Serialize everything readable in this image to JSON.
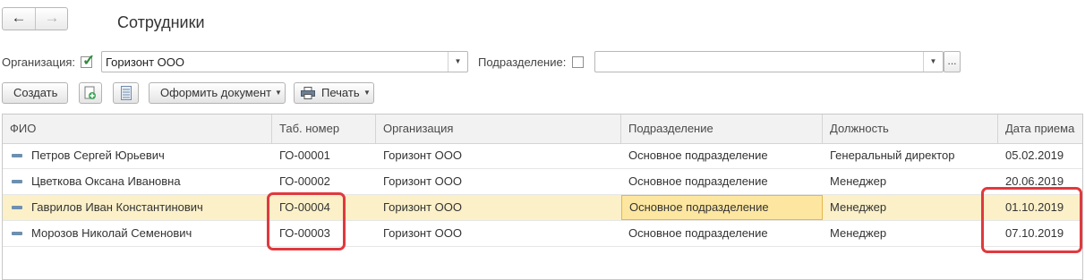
{
  "window": {
    "title": "Сотрудники"
  },
  "nav": {
    "back_icon": "←",
    "forward_icon": "→"
  },
  "filters": {
    "org_label": "Организация:",
    "org_checked": true,
    "org_value": "Горизонт ООО",
    "dept_label": "Подразделение:",
    "dept_checked": false,
    "dept_value": "",
    "more_label": "..."
  },
  "toolbar": {
    "create_label": "Создать",
    "format_doc_label": "Оформить документ",
    "print_label": "Печать"
  },
  "table": {
    "columns": [
      "ФИО",
      "Таб. номер",
      "Организация",
      "Подразделение",
      "Должность",
      "Дата приема"
    ],
    "rows": [
      {
        "fio": "Петров Сергей Юрьевич",
        "tab": "ГО-00001",
        "org": "Горизонт ООО",
        "dept": "Основное подразделение",
        "pos": "Генеральный директор",
        "date": "05.02.2019"
      },
      {
        "fio": "Цветкова Оксана Ивановна",
        "tab": "ГО-00002",
        "org": "Горизонт ООО",
        "dept": "Основное подразделение",
        "pos": "Менеджер",
        "date": "20.06.2019"
      },
      {
        "fio": "Гаврилов Иван Константинович",
        "tab": "ГО-00004",
        "org": "Горизонт ООО",
        "dept": "Основное подразделение",
        "pos": "Менеджер",
        "date": "01.10.2019"
      },
      {
        "fio": "Морозов Николай Семенович",
        "tab": "ГО-00003",
        "org": "Горизонт ООО",
        "dept": "Основное подразделение",
        "pos": "Менеджер",
        "date": "07.10.2019"
      }
    ],
    "selected_row": 2
  },
  "colors": {
    "highlight": "#e0393e",
    "selected_row": "#fbf0c8",
    "current_cell": "#fde6a0",
    "check": "#2e8b3a"
  }
}
